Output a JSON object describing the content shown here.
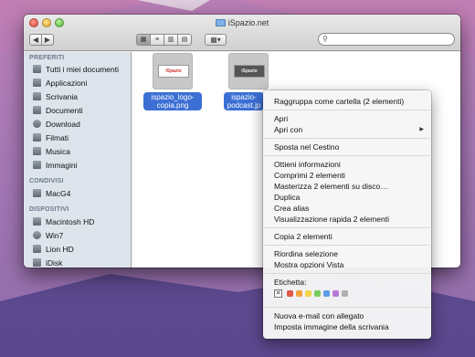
{
  "window": {
    "title": "iSpazio.net",
    "nav_back": "◀",
    "nav_fwd": "▶",
    "search_placeholder": ""
  },
  "sidebar": {
    "headers": [
      "PREFERITI",
      "CONDIVISI",
      "DISPOSITIVI"
    ],
    "favorites": [
      {
        "label": "Tutti i miei documenti",
        "icon": "all-files-icon"
      },
      {
        "label": "Applicazioni",
        "icon": "applications-icon"
      },
      {
        "label": "Scrivania",
        "icon": "desktop-icon"
      },
      {
        "label": "Documenti",
        "icon": "documents-icon"
      },
      {
        "label": "Download",
        "icon": "download-icon"
      },
      {
        "label": "Filmati",
        "icon": "movies-icon"
      },
      {
        "label": "Musica",
        "icon": "music-icon"
      },
      {
        "label": "Immagini",
        "icon": "pictures-icon"
      }
    ],
    "shared": [
      {
        "label": "MacG4",
        "icon": "network-computer-icon"
      }
    ],
    "devices": [
      {
        "label": "Macintosh HD",
        "icon": "hard-disk-icon"
      },
      {
        "label": "Win7",
        "icon": "disk-icon"
      },
      {
        "label": "Lion HD",
        "icon": "hard-disk-icon"
      },
      {
        "label": "iDisk",
        "icon": "idisk-icon"
      }
    ]
  },
  "files": [
    {
      "line1": "ispazio_logo-",
      "line2": "copia.png",
      "thumb_text": "iSpazio"
    },
    {
      "line1": "ispazio-",
      "line2": "podcast.jp",
      "thumb_text": "iSpazio"
    }
  ],
  "context_menu": {
    "items": [
      "Raggruppa come cartella (2 elementi)",
      "Apri",
      "Apri con",
      "Sposta nel Cestino",
      "Ottieni informazioni",
      "Comprimi 2 elementi",
      "Masterizza 2 elementi su disco…",
      "Duplica",
      "Crea alias",
      "Visualizzazione rapida 2 elementi",
      "Copia 2 elementi",
      "Riordina selezione",
      "Mostra opzioni Vista",
      "Etichetta:",
      "Nuova e-mail con allegato",
      "Imposta immagine della scrivania"
    ],
    "label_colors": [
      "#e0584a",
      "#f0a23c",
      "#f2d64a",
      "#7bcc5a",
      "#5c9ee8",
      "#b57ad6",
      "#b0b0b0"
    ]
  },
  "colors": {
    "selection": "#3b6fd4",
    "sidebar_bg": "#dde4ec"
  }
}
